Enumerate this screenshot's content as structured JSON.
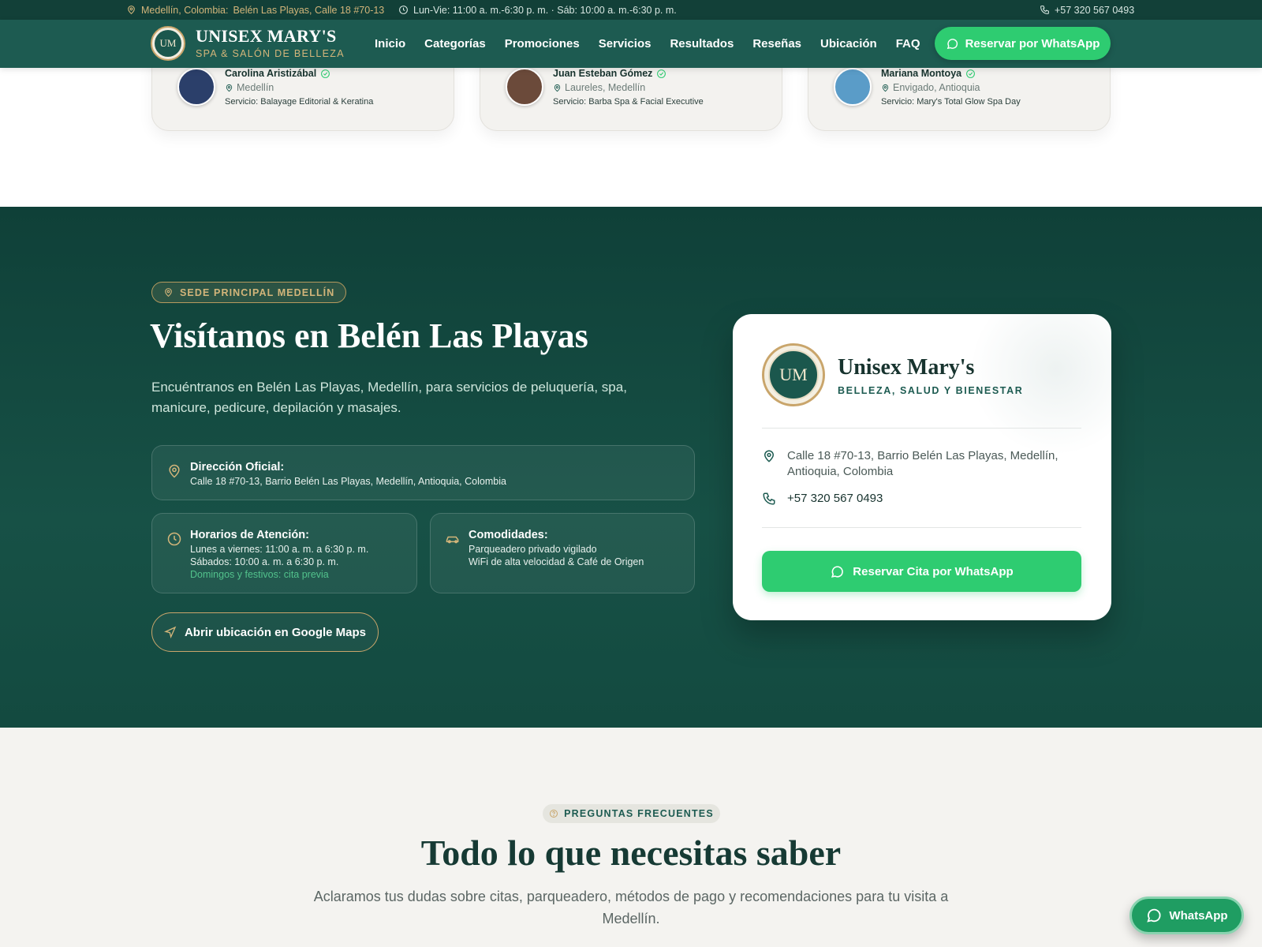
{
  "topbar": {
    "location_label": "Medellín, Colombia:",
    "location_address": "Belén Las Playas, Calle 18 #70-13",
    "hours": "Lun-Vie: 11:00 a. m.-6:30 p. m. · Sáb: 10:00 a. m.-6:30 p. m.",
    "phone": "+57 320 567 0493"
  },
  "header": {
    "logo_initials": "UM",
    "brand_title": "UNISEX MARY'S",
    "brand_subtitle": "SPA & SALÓN DE BELLEZA",
    "nav": [
      "Inicio",
      "Categorías",
      "Promociones",
      "Servicios",
      "Resultados",
      "Reseñas",
      "Ubicación",
      "FAQ"
    ],
    "cta": "Reservar por WhatsApp"
  },
  "reviews": [
    {
      "name": "Carolina Aristizábal",
      "location": "Medellín",
      "service": "Servicio: Balayage Editorial & Keratina",
      "avatar_color": "#2b3f6a"
    },
    {
      "name": "Juan Esteban Gómez",
      "location": "Laureles, Medellín",
      "service": "Servicio: Barba Spa & Facial Executive",
      "avatar_color": "#6b4a3a"
    },
    {
      "name": "Mariana Montoya",
      "location": "Envigado, Antioquia",
      "service": "Servicio: Mary's Total Glow Spa Day",
      "avatar_color": "#5a9cc8"
    }
  ],
  "location": {
    "badge": "SEDE PRINCIPAL MEDELLÍN",
    "title": "Visítanos en Belén Las Playas",
    "description": "Encuéntranos en Belén Las Playas, Medellín, para servicios de peluquería, spa, manicure, pedicure, depilación y masajes.",
    "address": {
      "heading": "Dirección Oficial:",
      "line": "Calle 18 #70-13, Barrio Belén Las Playas, Medellín, Antioquia, Colombia"
    },
    "hours": {
      "heading": "Horarios de Atención:",
      "line1": "Lunes a viernes: 11:00 a. m. a 6:30 p. m.",
      "line2": "Sábados: 10:00 a. m. a 6:30 p. m.",
      "line3": "Domingos y festivos: cita previa"
    },
    "amenities": {
      "heading": "Comodidades:",
      "line1": "Parqueadero privado vigilado",
      "line2": "WiFi de alta velocidad & Café de Origen"
    },
    "maps_button": "Abrir ubicación en Google Maps"
  },
  "contact_card": {
    "logo_initials": "UM",
    "name": "Unisex Mary's",
    "tagline": "BELLEZA, SALUD Y BIENESTAR",
    "address": "Calle 18 #70-13, Barrio Belén Las Playas, Medellín, Antioquia, Colombia",
    "phone": "+57 320 567 0493",
    "button": "Reservar Cita por WhatsApp"
  },
  "faq": {
    "badge": "PREGUNTAS FRECUENTES",
    "title": "Todo lo que necesitas saber",
    "description": "Aclaramos tus dudas sobre citas, parqueadero, métodos de pago y recomendaciones para tu visita a Medellín."
  },
  "floating_whatsapp": "WhatsApp",
  "colors": {
    "primary": "#1d5b51",
    "gold": "#c9a56b",
    "whatsapp": "#2ecc71"
  }
}
